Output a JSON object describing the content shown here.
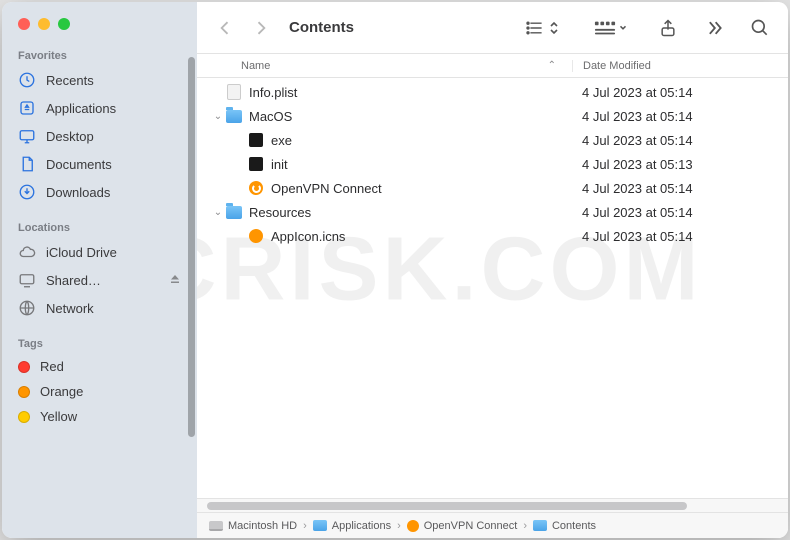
{
  "window": {
    "title": "Contents"
  },
  "sidebar": {
    "favorites_label": "Favorites",
    "locations_label": "Locations",
    "tags_label": "Tags",
    "favorites": [
      {
        "label": "Recents"
      },
      {
        "label": "Applications"
      },
      {
        "label": "Desktop"
      },
      {
        "label": "Documents"
      },
      {
        "label": "Downloads"
      }
    ],
    "locations": [
      {
        "label": "iCloud Drive"
      },
      {
        "label": "Shared…"
      },
      {
        "label": "Network"
      }
    ],
    "tags": [
      {
        "label": "Red",
        "color": "#ff3b30"
      },
      {
        "label": "Orange",
        "color": "#ff9500"
      },
      {
        "label": "Yellow",
        "color": "#ffcc00"
      }
    ]
  },
  "columns": {
    "name": "Name",
    "date_modified": "Date Modified"
  },
  "files": [
    {
      "indent": 0,
      "kind": "plist",
      "name": "Info.plist",
      "date": "4 Jul 2023 at 05:14",
      "disclosure": ""
    },
    {
      "indent": 0,
      "kind": "folder",
      "name": "MacOS",
      "date": "4 Jul 2023 at 05:14",
      "disclosure": "open"
    },
    {
      "indent": 1,
      "kind": "exec",
      "name": "exe",
      "date": "4 Jul 2023 at 05:14",
      "disclosure": ""
    },
    {
      "indent": 1,
      "kind": "exec",
      "name": "init",
      "date": "4 Jul 2023 at 05:13",
      "disclosure": ""
    },
    {
      "indent": 1,
      "kind": "app",
      "name": "OpenVPN Connect",
      "date": "4 Jul 2023 at 05:14",
      "disclosure": ""
    },
    {
      "indent": 0,
      "kind": "folder",
      "name": "Resources",
      "date": "4 Jul 2023 at 05:14",
      "disclosure": "open"
    },
    {
      "indent": 1,
      "kind": "icns",
      "name": "AppIcon.icns",
      "date": "4 Jul 2023 at 05:14",
      "disclosure": ""
    }
  ],
  "path": [
    {
      "kind": "disk",
      "label": "Macintosh HD"
    },
    {
      "kind": "folder",
      "label": "Applications"
    },
    {
      "kind": "app",
      "label": "OpenVPN Connect"
    },
    {
      "kind": "folder",
      "label": "Contents"
    }
  ],
  "watermark": "PCRISK.COM"
}
